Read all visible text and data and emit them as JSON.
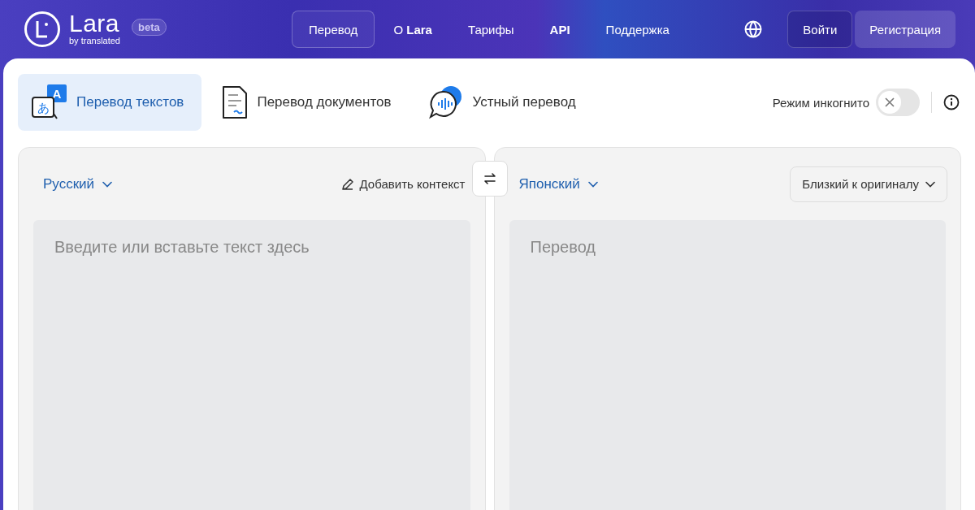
{
  "header": {
    "logo": {
      "name": "Lara",
      "tagline": "by translated",
      "badge": "beta"
    },
    "nav": [
      {
        "label": "Перевод",
        "selected": true,
        "kind": "plain"
      },
      {
        "label": "О **Lara**",
        "selected": false,
        "kind": "plain"
      },
      {
        "label": "Тарифы",
        "selected": false,
        "kind": "plain"
      },
      {
        "label": "API",
        "selected": false,
        "kind": "strong"
      },
      {
        "label": "Поддержка",
        "selected": false,
        "kind": "plain"
      }
    ],
    "login": "Войти",
    "signup": "Регистрация"
  },
  "modes": [
    {
      "label": "Перевод текстов",
      "selected": true,
      "kind": "text",
      "icon_letters": [
        "A",
        "あ"
      ]
    },
    {
      "label": "Перевод документов",
      "selected": false,
      "kind": "document"
    },
    {
      "label": "Устный перевод",
      "selected": false,
      "kind": "voice"
    }
  ],
  "incognito": {
    "label": "Режим инкогнито",
    "on": false
  },
  "source": {
    "language": "Русский",
    "context": "Добавить контекст",
    "placeholder": "Введите или вставьте текст здесь"
  },
  "target": {
    "language": "Японский",
    "style": "Близкий к оригиналу",
    "placeholder": "Перевод"
  }
}
